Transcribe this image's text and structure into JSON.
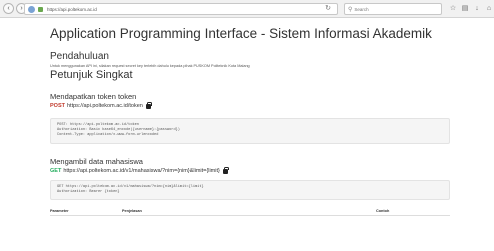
{
  "browser": {
    "url": "https://api.poltekom.ac.id",
    "search_placeholder": "Search"
  },
  "page": {
    "title": "Application Programming Interface - Sistem Informasi Akademik",
    "intro_heading": "Pendahuluan",
    "intro_text": "Untuk menggunakan API ini, silakan request secret key terlebih dahulu kepada pihak PUSKOM Politeknik Kota Malang",
    "guide_heading": "Petunjuk Singkat"
  },
  "sections": [
    {
      "heading": "Mendapatkan token token",
      "method": "POST",
      "url": "https://api.poltekom.ac.id/token",
      "code_lines": [
        "POST: https://api.poltekom.ac.id/token",
        "Authorization: Basic base64_encode({username}:{password})",
        "Content-Type: application/x-www-form-urlencoded"
      ]
    },
    {
      "heading": "Mengambil data mahasiswa",
      "method": "GET",
      "url": "https://api.poltekom.ac.id/v1/mahasiswa/?nim={nim}&limit={limit}",
      "code_lines": [
        "GET https://api.poltekom.ac.id/v1/mahasiswa/?nim={nim}&limit={limit}",
        "Authorization: Bearer {token}"
      ]
    }
  ],
  "table": {
    "columns": [
      "Parameter",
      "Penjelasan",
      "Contoh"
    ]
  }
}
